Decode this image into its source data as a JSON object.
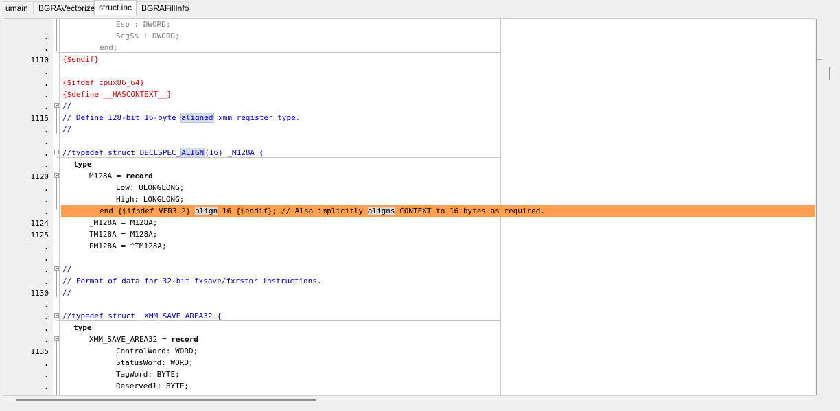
{
  "tabs": [
    {
      "label": "umain",
      "active": false
    },
    {
      "label": "BGRAVectorize",
      "active": false
    },
    {
      "label": "struct.inc",
      "active": true
    },
    {
      "label": "BGRAFillInfo",
      "active": false
    }
  ],
  "gutter": {
    "dot": ".",
    "numbers": {
      "l1110": "1110",
      "l1115": "1115",
      "l1120": "1120",
      "l1124": "1124",
      "l1125": "1125",
      "l1130": "1130",
      "l1135": "1135"
    }
  },
  "code": {
    "esp": "Esp : DWORD;",
    "segss": "SegSs : DWORD;",
    "end1": "end;",
    "endif1": "{$endif}",
    "ifdef": "{$ifdef cpux86_64}",
    "define": "{$define __HASCONTEXT__}",
    "c1": "//",
    "c2a": "// Define 128-bit 16-byte ",
    "c2b": "aligned",
    "c2c": " xmm register type.",
    "c3": "//",
    "td1a": "//typedef struct DECLSPEC_",
    "td1b": "ALIGN",
    "td1c": "(16) _M128A {",
    "type1": "type",
    "m128a_a": "M128A = ",
    "m128a_b": "record",
    "low": "Low: ULONGLONG;",
    "high": "High: LONGLONG;",
    "cur_a": "end {$ifndef VER3_2} ",
    "cur_b": "align",
    "cur_c": " 16 {$endif}; // Also implicitly ",
    "cur_d": "aligns",
    "cur_e": " CONTEXT to 16 bytes as required.",
    "um128a": "_M128A = M128A;",
    "tm128a": "TM128A = M128A;",
    "pm128a": "PM128A = ^TM128A;",
    "c4": "//",
    "c5": "// Format of data for 32-bit fxsave/fxrstor instructions.",
    "c6": "//",
    "td2": "//typedef struct _XMM_SAVE_AREA32 {",
    "type2": "type",
    "xmm_a": "XMM_SAVE_AREA32 = ",
    "xmm_b": "record",
    "ctrl": "ControlWord: WORD;",
    "status": "StatusWord: WORD;",
    "tag": "TagWord: BYTE;",
    "res1": "Reserved1: BYTE;"
  },
  "colors": {
    "current_line": "#ff9f4f",
    "comment": "#0000cc",
    "directive": "#e00000"
  }
}
